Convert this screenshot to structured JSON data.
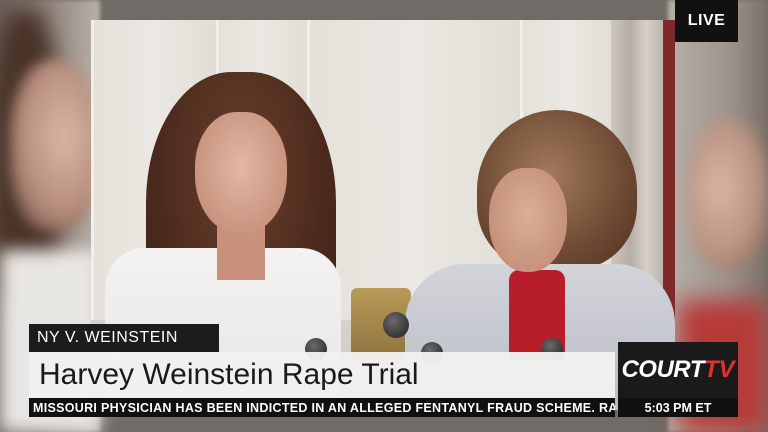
{
  "live_badge": "LIVE",
  "case_tag": "NY V. WEINSTEIN",
  "headline": "Harvey Weinstein Rape Trial",
  "ticker": "MISSOURI PHYSICIAN HAS BEEN INDICTED IN AN ALLEGED FENTANYL FRAUD SCHEME.  RAND",
  "logo": {
    "court": "COURT",
    "tv": "TV"
  },
  "clock": "5:03 PM ET",
  "colors": {
    "bar_dark": "#1c1c1c",
    "headline_bg": "#f0f0f0",
    "brand_red": "#e0312b"
  }
}
